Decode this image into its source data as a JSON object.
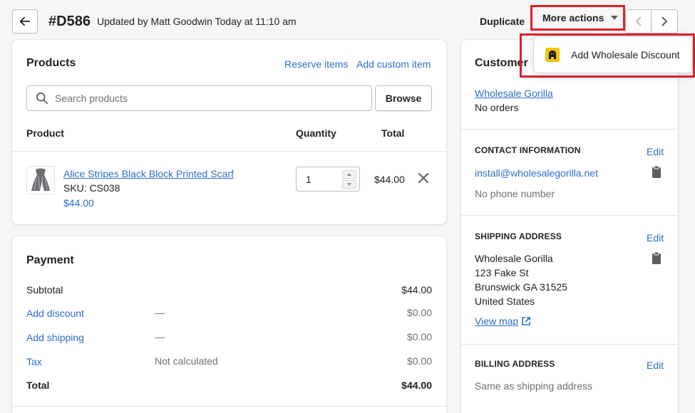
{
  "header": {
    "order_id": "#D586",
    "updated_text": "Updated by Matt Goodwin Today at 11:10 am",
    "duplicate_label": "Duplicate",
    "more_actions_label": "More actions"
  },
  "dropdown": {
    "items": [
      {
        "label": "Add Wholesale Discount",
        "icon": "gorilla-app-icon"
      }
    ]
  },
  "products": {
    "title": "Products",
    "reserve_label": "Reserve items",
    "add_custom_label": "Add custom item",
    "search_placeholder": "Search products",
    "browse_label": "Browse",
    "col_product": "Product",
    "col_quantity": "Quantity",
    "col_total": "Total",
    "item": {
      "name": "Alice Stripes Black Block Printed Scarf",
      "sku": "SKU: CS038",
      "price": "$44.00",
      "quantity": "1",
      "total": "$44.00"
    }
  },
  "payment": {
    "title": "Payment",
    "rows": [
      {
        "label": "Subtotal",
        "desc": "",
        "amount": "$44.00"
      },
      {
        "label": "Add discount",
        "desc": "—",
        "amount": "$0.00"
      },
      {
        "label": "Add shipping",
        "desc": "—",
        "amount": "$0.00"
      },
      {
        "label": "Tax",
        "desc": "Not calculated",
        "amount": "$0.00"
      },
      {
        "label": "Total",
        "desc": "",
        "amount": "$44.00"
      }
    ]
  },
  "customer": {
    "title": "Customer",
    "name": "Wholesale Gorilla",
    "orders": "No orders",
    "contact_heading": "CONTACT INFORMATION",
    "edit_label": "Edit",
    "email": "install@wholesalegorilla.net",
    "phone": "No phone number",
    "shipping_heading": "SHIPPING ADDRESS",
    "shipping_lines": [
      "Wholesale Gorilla",
      "123 Fake St",
      "Brunswick GA 31525",
      "United States"
    ],
    "view_map": "View map",
    "billing_heading": "BILLING ADDRESS",
    "billing_text": "Same as shipping address"
  },
  "colors": {
    "link": "#2c6ecb",
    "highlight": "#e0202a"
  }
}
